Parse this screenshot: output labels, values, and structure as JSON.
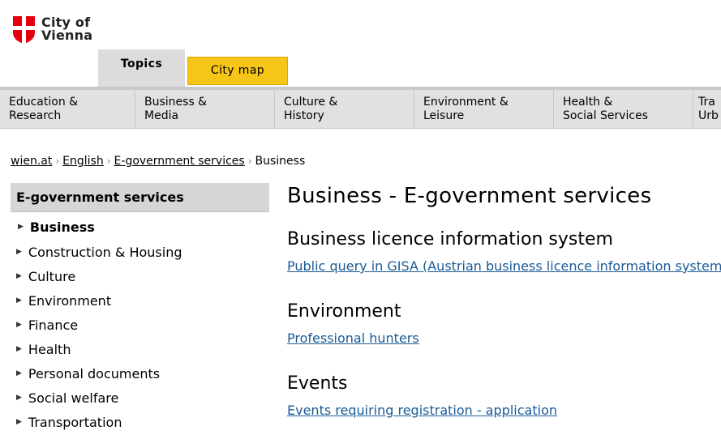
{
  "logo": {
    "line1": "City of",
    "line2": "Vienna"
  },
  "topnav": {
    "topics": "Topics",
    "city_map": "City map"
  },
  "categories": [
    {
      "label": "Education &\nResearch",
      "width": 167
    },
    {
      "label": "Business &\nMedia",
      "width": 172
    },
    {
      "label": "Culture &\nHistory",
      "width": 172
    },
    {
      "label": "Environment &\nLeisure",
      "width": 172
    },
    {
      "label": "Health &\nSocial Services",
      "width": 172
    },
    {
      "label": "Tra\nUrb",
      "width": 40
    }
  ],
  "breadcrumb": {
    "home": "wien.at",
    "english": "English",
    "egov": "E-government services",
    "current": "Business"
  },
  "sidebar": {
    "heading": "E-government services",
    "items": [
      "Business",
      "Construction & Housing",
      "Culture",
      "Environment",
      "Finance",
      "Health",
      "Personal documents",
      "Social welfare",
      "Transportation"
    ]
  },
  "main": {
    "title": "Business - E-government services",
    "sections": [
      {
        "heading": "Business licence information system",
        "link": "Public query in GISA (Austrian business licence information system)"
      },
      {
        "heading": "Environment",
        "link": "Professional hunters"
      },
      {
        "heading": "Events",
        "link": "Events requiring registration - application"
      }
    ]
  },
  "colors": {
    "citymap_tab": "#f5c518",
    "link": "#1a5a96",
    "logo_red": "#e3000f"
  }
}
